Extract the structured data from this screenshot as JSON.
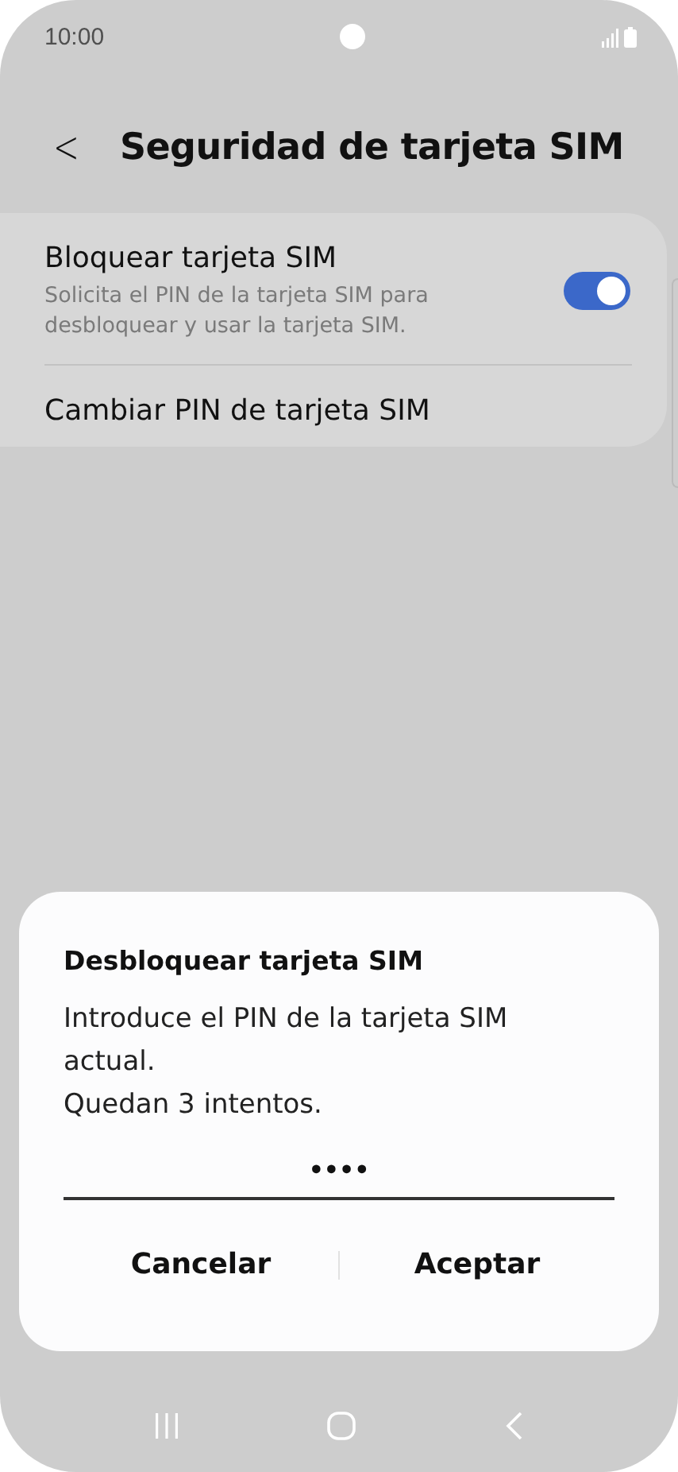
{
  "status_bar": {
    "time": "10:00"
  },
  "header": {
    "back": "<",
    "title": "Seguridad de tarjeta SIM"
  },
  "settings": [
    {
      "kind": "toggle",
      "title": "Bloquear tarjeta SIM",
      "subtitle": "Solicita el PIN de la tarjeta SIM para desbloquear y usar la tarjeta SIM.",
      "on": true
    },
    {
      "kind": "plain",
      "title": "Cambiar PIN de tarjeta SIM"
    }
  ],
  "dialog": {
    "title": "Desbloquear tarjeta SIM",
    "message": [
      "Introduce el PIN de la tarjeta SIM actual.",
      "Quedan 3 intentos."
    ],
    "pin_field": {
      "value": "••••"
    },
    "buttons": [
      "Cancelar",
      "Aceptar"
    ]
  }
}
